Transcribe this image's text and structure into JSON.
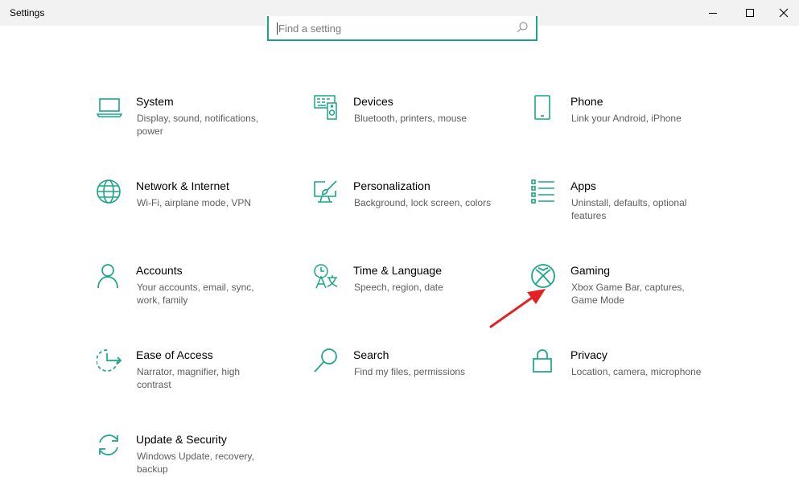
{
  "window": {
    "title": "Settings"
  },
  "search": {
    "placeholder": "Find a setting"
  },
  "accent": "#1aa58a",
  "annotation_color": "#e52222",
  "tiles": [
    {
      "title": "System",
      "desc": "Display, sound, notifications, power",
      "icon": "laptop-icon"
    },
    {
      "title": "Devices",
      "desc": "Bluetooth, printers, mouse",
      "icon": "devices-icon"
    },
    {
      "title": "Phone",
      "desc": "Link your Android, iPhone",
      "icon": "phone-icon"
    },
    {
      "title": "Network & Internet",
      "desc": "Wi-Fi, airplane mode, VPN",
      "icon": "globe-icon"
    },
    {
      "title": "Personalization",
      "desc": "Background, lock screen, colors",
      "icon": "paintbrush-icon"
    },
    {
      "title": "Apps",
      "desc": "Uninstall, defaults, optional features",
      "icon": "apps-list-icon"
    },
    {
      "title": "Accounts",
      "desc": "Your accounts, email, sync, work, family",
      "icon": "person-icon"
    },
    {
      "title": "Time & Language",
      "desc": "Speech, region, date",
      "icon": "time-language-icon"
    },
    {
      "title": "Gaming",
      "desc": "Xbox Game Bar, captures, Game Mode",
      "icon": "xbox-icon"
    },
    {
      "title": "Ease of Access",
      "desc": "Narrator, magnifier, high contrast",
      "icon": "ease-of-access-icon"
    },
    {
      "title": "Search",
      "desc": "Find my files, permissions",
      "icon": "search-icon"
    },
    {
      "title": "Privacy",
      "desc": "Location, camera, microphone",
      "icon": "lock-icon"
    },
    {
      "title": "Update & Security",
      "desc": "Windows Update, recovery, backup",
      "icon": "update-icon"
    }
  ]
}
